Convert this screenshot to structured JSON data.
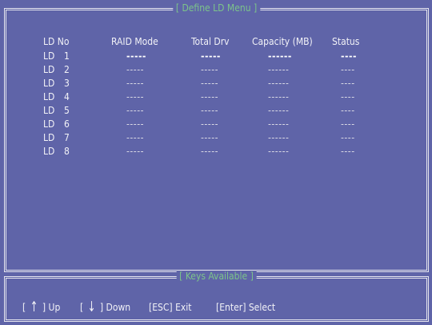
{
  "menu_title": "[ Define LD Menu ]",
  "table": {
    "headers": {
      "ld_no": "LD No",
      "raid_mode": "RAID Mode",
      "total_drv": "Total Drv",
      "capacity": "Capacity (MB)",
      "status": "Status"
    },
    "rows": [
      {
        "ld": "LD",
        "num": "1",
        "raid": "-----",
        "drv": "-----",
        "cap": "------",
        "status": "----"
      },
      {
        "ld": "LD",
        "num": "2",
        "raid": "-----",
        "drv": "-----",
        "cap": "------",
        "status": "----"
      },
      {
        "ld": "LD",
        "num": "3",
        "raid": "-----",
        "drv": "-----",
        "cap": "------",
        "status": "----"
      },
      {
        "ld": "LD",
        "num": "4",
        "raid": "-----",
        "drv": "-----",
        "cap": "------",
        "status": "----"
      },
      {
        "ld": "LD",
        "num": "5",
        "raid": "-----",
        "drv": "-----",
        "cap": "------",
        "status": "----"
      },
      {
        "ld": "LD",
        "num": "6",
        "raid": "-----",
        "drv": "-----",
        "cap": "------",
        "status": "----"
      },
      {
        "ld": "LD",
        "num": "7",
        "raid": "-----",
        "drv": "-----",
        "cap": "------",
        "status": "----"
      },
      {
        "ld": "LD",
        "num": "8",
        "raid": "-----",
        "drv": "-----",
        "cap": "------",
        "status": "----"
      }
    ]
  },
  "keys_panel": {
    "title": "[ Keys Available ]",
    "up_open": "[",
    "up_arrow": "↑",
    "up_close": "] Up",
    "down_open": "[",
    "down_arrow": "↓",
    "down_close": "] Down",
    "esc": "[ESC] Exit",
    "enter": "[Enter] Select"
  },
  "colors": {
    "background": "#5f64a8",
    "frame": "#e6e6ef",
    "title": "#7cc48a",
    "text": "#f2f2f7"
  }
}
